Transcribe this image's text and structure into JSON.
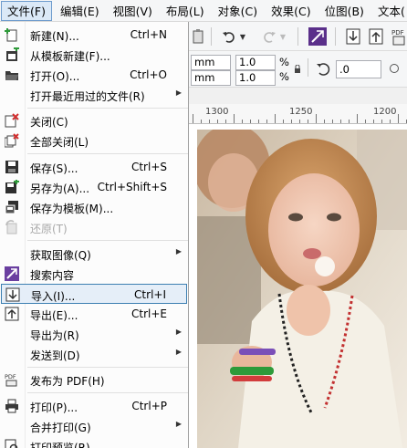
{
  "menubar": {
    "items": [
      {
        "label": "文件(F)",
        "active": true
      },
      {
        "label": "编辑(E)"
      },
      {
        "label": "视图(V)"
      },
      {
        "label": "布局(L)"
      },
      {
        "label": "对象(C)"
      },
      {
        "label": "效果(C)"
      },
      {
        "label": "位图(B)"
      },
      {
        "label": "文本("
      }
    ]
  },
  "propbar": {
    "unit1": "mm",
    "unit2": "mm",
    "scale1": "1.0",
    "scale2": "1.0",
    "pct1": "%",
    "pct2": "%",
    "rotation": ".0"
  },
  "ruler": {
    "labels": [
      "1300",
      "1250",
      "1200"
    ]
  },
  "file_menu": {
    "items": [
      {
        "label": "新建(N)...",
        "shortcut": "Ctrl+N",
        "icon": "new-document-icon"
      },
      {
        "label": "从模板新建(F)...",
        "shortcut": "",
        "icon": "new-from-template-icon"
      },
      {
        "label": "打开(O)...",
        "shortcut": "Ctrl+O",
        "icon": "open-folder-icon"
      },
      {
        "label": "打开最近用过的文件(R)",
        "shortcut": "",
        "submenu": true
      },
      {
        "label": "关闭(C)",
        "shortcut": "",
        "icon": "close-document-icon"
      },
      {
        "label": "全部关闭(L)",
        "shortcut": "",
        "icon": "close-all-icon"
      },
      {
        "label": "保存(S)...",
        "shortcut": "Ctrl+S",
        "icon": "save-icon"
      },
      {
        "label": "另存为(A)...",
        "shortcut": "Ctrl+Shift+S",
        "icon": "save-as-icon"
      },
      {
        "label": "保存为模板(M)...",
        "shortcut": "",
        "icon": "save-template-icon"
      },
      {
        "label": "还原(T)",
        "shortcut": "",
        "icon": "revert-icon",
        "disabled": true
      },
      {
        "label": "获取图像(Q)",
        "shortcut": "",
        "submenu": true
      },
      {
        "label": "搜索内容",
        "shortcut": "",
        "icon": "search-content-icon"
      },
      {
        "label": "导入(I)...",
        "shortcut": "Ctrl+I",
        "icon": "import-icon",
        "highlighted": true
      },
      {
        "label": "导出(E)...",
        "shortcut": "Ctrl+E",
        "icon": "export-icon"
      },
      {
        "label": "导出为(R)",
        "shortcut": "",
        "submenu": true
      },
      {
        "label": "发送到(D)",
        "shortcut": "",
        "submenu": true
      },
      {
        "label": "发布为 PDF(H)",
        "shortcut": "",
        "icon": "pdf-icon"
      },
      {
        "label": "打印(P)...",
        "shortcut": "Ctrl+P",
        "icon": "print-icon"
      },
      {
        "label": "合并打印(G)",
        "shortcut": "",
        "submenu": true
      },
      {
        "label": "打印预览(R)",
        "shortcut": "",
        "icon": "print-preview-icon"
      }
    ]
  },
  "colors": {
    "accent": "#3c7fb1",
    "highlight": "#e5eef8",
    "search_purple": "#6a3fa0",
    "icon_green": "#2e9a3a"
  }
}
